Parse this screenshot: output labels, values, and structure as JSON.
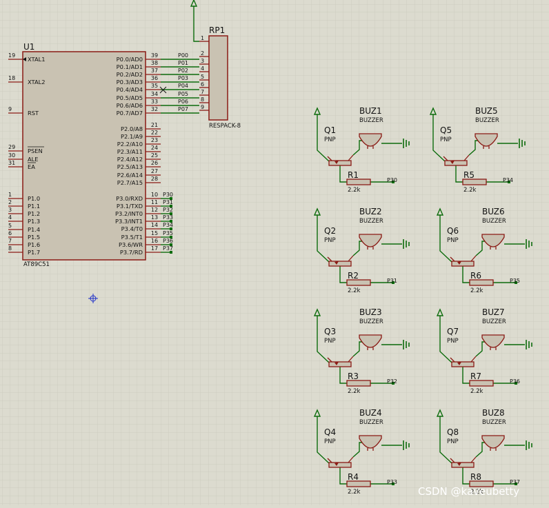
{
  "watermark": "CSDN @kaveubetty",
  "mcu": {
    "ref": "U1",
    "part": "AT89C51",
    "left_pins": [
      {
        "num": "19",
        "name": "XTAL1"
      },
      {
        "num": "18",
        "name": "XTAL2"
      },
      {
        "num": "9",
        "name": "RST"
      },
      {
        "num": "29",
        "name": "PSEN"
      },
      {
        "num": "30",
        "name": "ALE"
      },
      {
        "num": "31",
        "name": "EA"
      },
      {
        "num": "1",
        "name": "P1.0"
      },
      {
        "num": "2",
        "name": "P1.1"
      },
      {
        "num": "3",
        "name": "P1.2"
      },
      {
        "num": "4",
        "name": "P1.3"
      },
      {
        "num": "5",
        "name": "P1.4"
      },
      {
        "num": "6",
        "name": "P1.5"
      },
      {
        "num": "7",
        "name": "P1.6"
      },
      {
        "num": "8",
        "name": "P1.7"
      }
    ],
    "right_pins": [
      {
        "num": "39",
        "name": "P0.0/AD0",
        "net": "P00"
      },
      {
        "num": "38",
        "name": "P0.1/AD1",
        "net": "P01"
      },
      {
        "num": "37",
        "name": "P0.2/AD2",
        "net": "P02"
      },
      {
        "num": "36",
        "name": "P0.3/AD3",
        "net": "P03"
      },
      {
        "num": "35",
        "name": "P0.4/AD4",
        "net": "P04"
      },
      {
        "num": "34",
        "name": "P0.5/AD5",
        "net": "P05"
      },
      {
        "num": "33",
        "name": "P0.6/AD6",
        "net": "P06"
      },
      {
        "num": "32",
        "name": "P0.7/AD7",
        "net": "P07"
      },
      {
        "num": "21",
        "name": "P2.0/A8",
        "net": ""
      },
      {
        "num": "22",
        "name": "P2.1/A9",
        "net": ""
      },
      {
        "num": "23",
        "name": "P2.2/A10",
        "net": ""
      },
      {
        "num": "24",
        "name": "P2.3/A11",
        "net": ""
      },
      {
        "num": "25",
        "name": "P2.4/A12",
        "net": ""
      },
      {
        "num": "26",
        "name": "P2.5/A13",
        "net": ""
      },
      {
        "num": "27",
        "name": "P2.6/A14",
        "net": ""
      },
      {
        "num": "28",
        "name": "P2.7/A15",
        "net": ""
      },
      {
        "num": "10",
        "name": "P3.0/RXD",
        "net": "P30"
      },
      {
        "num": "11",
        "name": "P3.1/TXD",
        "net": "P31"
      },
      {
        "num": "12",
        "name": "P3.2/INT0",
        "net": "P32"
      },
      {
        "num": "13",
        "name": "P3.3/INT1",
        "net": "P33"
      },
      {
        "num": "14",
        "name": "P3.4/T0",
        "net": "P34"
      },
      {
        "num": "15",
        "name": "P3.5/T1",
        "net": "P35"
      },
      {
        "num": "16",
        "name": "P3.6/WR",
        "net": "P36"
      },
      {
        "num": "17",
        "name": "P3.7/RD",
        "net": "P37"
      }
    ]
  },
  "respack": {
    "ref": "RP1",
    "part": "RESPACK-8",
    "pins": [
      "1",
      "2",
      "3",
      "4",
      "5",
      "6",
      "7",
      "8",
      "9"
    ]
  },
  "stages": [
    {
      "q": "Q1",
      "q_type": "PNP",
      "buz": "BUZ1",
      "buz_type": "BUZZER",
      "r": "R1",
      "r_val": "2.2k",
      "net": "P30"
    },
    {
      "q": "Q2",
      "q_type": "PNP",
      "buz": "BUZ2",
      "buz_type": "BUZZER",
      "r": "R2",
      "r_val": "2.2k",
      "net": "P31"
    },
    {
      "q": "Q3",
      "q_type": "PNP",
      "buz": "BUZ3",
      "buz_type": "BUZZER",
      "r": "R3",
      "r_val": "2.2k",
      "net": "P32"
    },
    {
      "q": "Q4",
      "q_type": "PNP",
      "buz": "BUZ4",
      "buz_type": "BUZZER",
      "r": "R4",
      "r_val": "2.2k",
      "net": "P33"
    },
    {
      "q": "Q5",
      "q_type": "PNP",
      "buz": "BUZ5",
      "buz_type": "BUZZER",
      "r": "R5",
      "r_val": "2.2k",
      "net": "P34"
    },
    {
      "q": "Q6",
      "q_type": "PNP",
      "buz": "BUZ6",
      "buz_type": "BUZZER",
      "r": "R6",
      "r_val": "2.2k",
      "net": "P35"
    },
    {
      "q": "Q7",
      "q_type": "PNP",
      "buz": "BUZ7",
      "buz_type": "BUZZER",
      "r": "R7",
      "r_val": "2.2k",
      "net": "P36"
    },
    {
      "q": "Q8",
      "q_type": "PNP",
      "buz": "BUZ8",
      "buz_type": "BUZZER",
      "r": "R8",
      "r_val": "2.2k",
      "net": "P37"
    }
  ],
  "colors": {
    "background": "#dcdbcf",
    "grid": "#c8c7ba",
    "component_fill": "#c9c2b2",
    "component_outline": "#8a1a14",
    "wire": "#0b6b0b",
    "text": "#111111"
  }
}
